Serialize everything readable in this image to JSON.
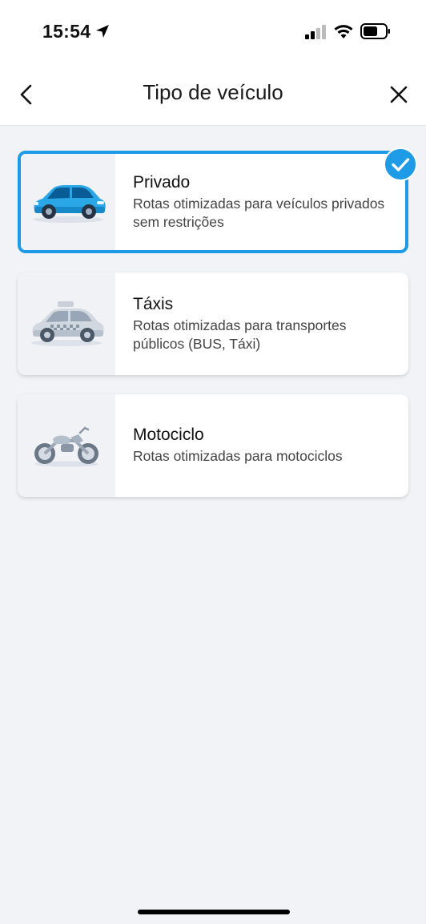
{
  "status_bar": {
    "time": "15:54",
    "icons": [
      "location-arrow-icon",
      "cellular-signal-icon",
      "wifi-icon",
      "battery-icon"
    ]
  },
  "nav": {
    "title": "Tipo de veículo",
    "back_icon": "chevron-left-icon",
    "close_icon": "close-icon"
  },
  "options": [
    {
      "title": "Privado",
      "description": "Rotas otimizadas para veículos privados sem restrições",
      "icon": "car-icon",
      "selected": true
    },
    {
      "title": "Táxis",
      "description": "Rotas otimizadas para transportes públicos (BUS, Táxi)",
      "icon": "taxi-icon",
      "selected": false
    },
    {
      "title": "Motociclo",
      "description": "Rotas otimizadas para motociclos",
      "icon": "motorcycle-icon",
      "selected": false
    }
  ],
  "colors": {
    "accent": "#1d9be6",
    "background": "#f1f3f7",
    "card": "#ffffff"
  }
}
